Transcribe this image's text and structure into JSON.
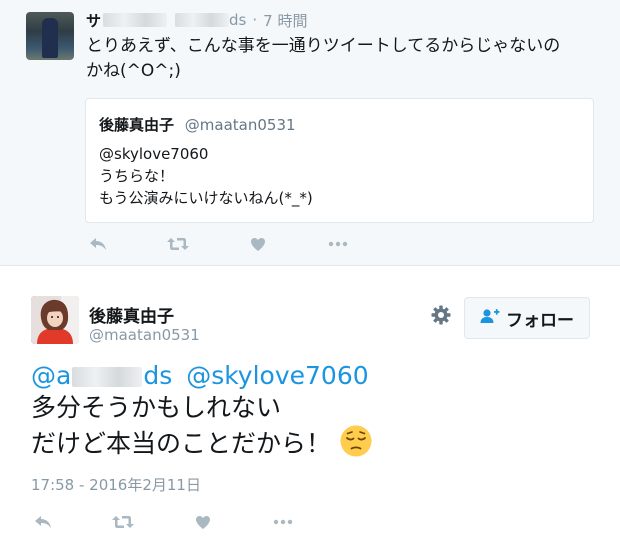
{
  "parent_tweet": {
    "name_visible": "サ",
    "handle_suffix": "ds",
    "separator": "·",
    "time": "7 時間",
    "text_line1": "とりあえず、こんな事を一通りツイートしてるからじゃないの",
    "text_line2": "かね(^O^;)",
    "avatar": "blue-jumpsuit-photo",
    "quoted": {
      "name": "後藤真由子",
      "handle": "@maatan0531",
      "line1": "@skylove7060",
      "line2": "うちらな！",
      "line3": "もう公演みにいけないねん(*_*)"
    },
    "actions": [
      "reply-icon",
      "retweet-icon",
      "like-icon",
      "more-icon"
    ]
  },
  "main_tweet": {
    "name": "後藤真由子",
    "handle": "@maatan0531",
    "avatar": "red-shirt-selfie",
    "follow_label": "フォロー",
    "mention1_prefix": "@a",
    "mention1_suffix": "ds",
    "mention2": "@skylove7060",
    "line2": "多分そうかもしれない",
    "line3": "だけど本当のことだから！",
    "emoji": "pensive-face",
    "timestamp": "17:58 - 2016年2月11日",
    "actions": [
      "reply-icon",
      "retweet-icon",
      "like-icon",
      "more-icon"
    ]
  },
  "colors": {
    "link": "#1b95e0",
    "muted": "#8899a6",
    "icon": "#aab8c2",
    "parent_bg": "#f5f8fa",
    "border": "#e1e8ed"
  }
}
